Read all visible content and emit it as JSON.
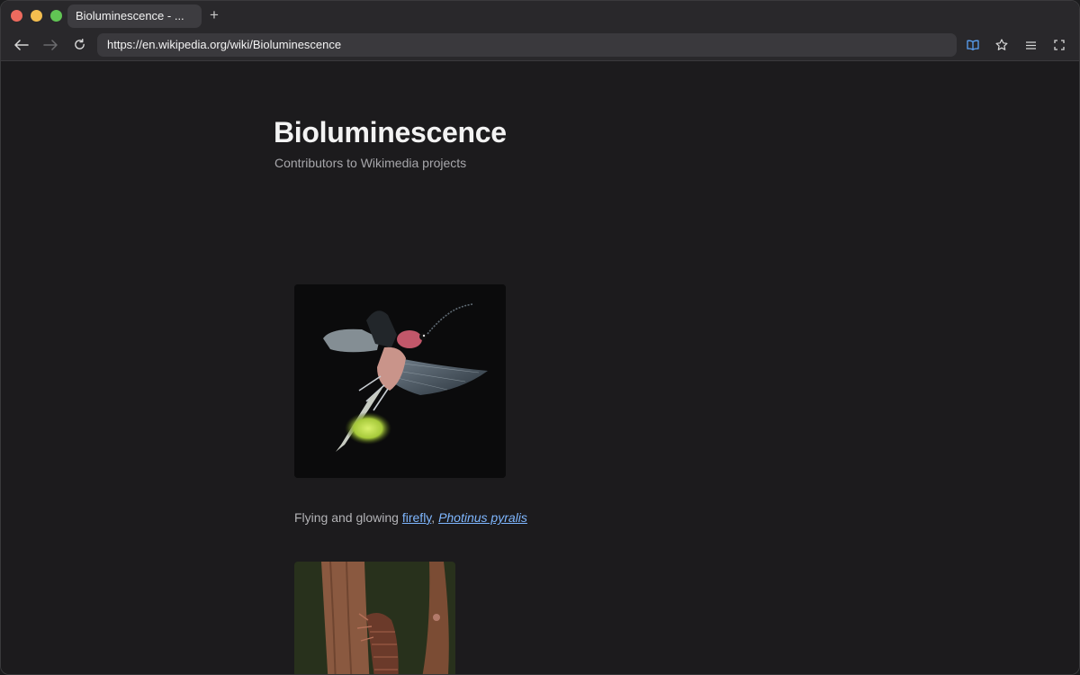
{
  "browser": {
    "tab_title": "Bioluminescence - ...",
    "new_tab_label": "+",
    "url": "https://en.wikipedia.org/wiki/Bioluminescence",
    "icons": {
      "back": "back-arrow-icon",
      "forward": "forward-arrow-icon",
      "reload": "reload-icon",
      "reader": "reader-mode-icon",
      "bookmark": "star-icon",
      "menu": "hamburger-menu-icon",
      "fullscreen": "fullscreen-icon"
    }
  },
  "article": {
    "title": "Bioluminescence",
    "byline": "Contributors to Wikimedia projects",
    "figures": [
      {
        "caption_prefix": "Flying and glowing ",
        "caption_link1": "firefly",
        "caption_sep": ", ",
        "caption_link2": "Photinus pyralis"
      }
    ]
  },
  "colors": {
    "page_bg": "#1c1b1d",
    "link": "#7fb7ff",
    "accent": "#5aa1f5"
  }
}
